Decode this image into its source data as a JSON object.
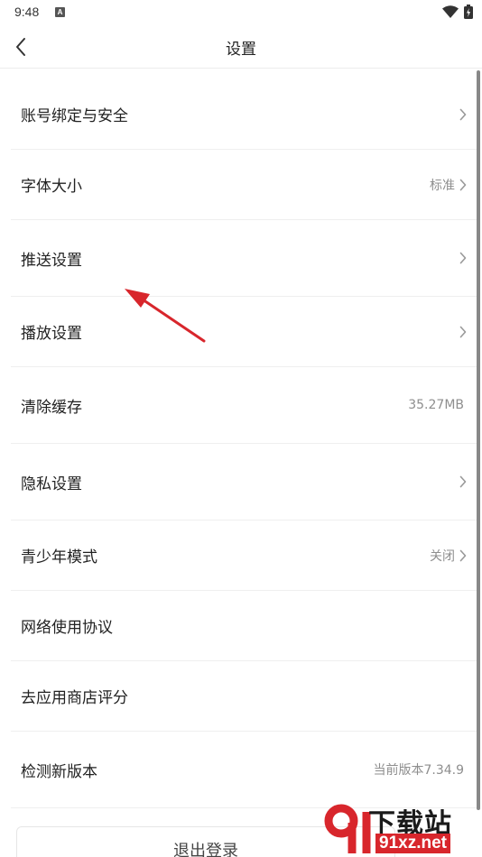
{
  "status_bar": {
    "time": "9:48",
    "notification_icon": "A"
  },
  "header": {
    "title": "设置",
    "back_icon": "chevron-left-icon"
  },
  "settings": [
    {
      "label": "账号绑定与安全",
      "value": "",
      "chevron": true
    },
    {
      "label": "字体大小",
      "value": "标准",
      "chevron": true
    },
    {
      "label": "推送设置",
      "value": "",
      "chevron": true
    },
    {
      "label": "播放设置",
      "value": "",
      "chevron": true
    },
    {
      "label": "清除缓存",
      "value": "35.27MB",
      "chevron": false
    },
    {
      "label": "隐私设置",
      "value": "",
      "chevron": true
    },
    {
      "label": "青少年模式",
      "value": "关闭",
      "chevron": true
    },
    {
      "label": "网络使用协议",
      "value": "",
      "chevron": false
    },
    {
      "label": "去应用商店评分",
      "value": "",
      "chevron": false
    },
    {
      "label": "检测新版本",
      "value": "当前版本7.34.9",
      "chevron": false
    }
  ],
  "logout": {
    "label": "退出登录"
  },
  "watermark": {
    "text": "下载站",
    "url": "91xz.net"
  },
  "colors": {
    "accent_red": "#d8262c",
    "arrow": "#d8262c"
  }
}
